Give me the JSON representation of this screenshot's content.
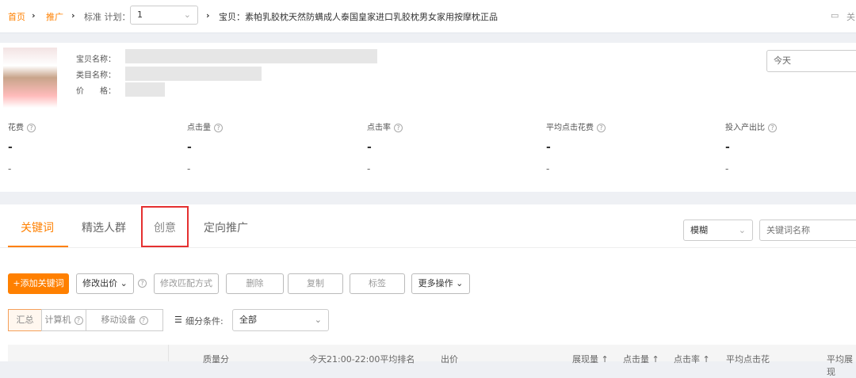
{
  "breadcrumb": {
    "home": "首页",
    "promo": "推广",
    "plan_label": "标准 计划：",
    "plan_value": "1",
    "item": "宝贝：素帕乳胶枕天然防螨成人泰国皇家进口乳胶枕男女家用按摩枕正品",
    "right": "关"
  },
  "product": {
    "name_label": "宝贝名称：",
    "category_label": "类目名称：",
    "price_label": "价　　格：",
    "date": "今天"
  },
  "metrics": [
    {
      "label": "花费",
      "v1": "-",
      "v2": "-"
    },
    {
      "label": "点击量",
      "v1": "-",
      "v2": "-"
    },
    {
      "label": "点击率",
      "v1": "-",
      "v2": "-"
    },
    {
      "label": "平均点击花费",
      "v1": "-",
      "v2": "-"
    },
    {
      "label": "投入产出比",
      "v1": "-",
      "v2": "-"
    }
  ],
  "tabs": [
    "关键词",
    "精选人群",
    "创意",
    "定向推广"
  ],
  "search": {
    "match": "模糊",
    "placeholder": "关键词名称"
  },
  "toolbar": {
    "add": "+添加关键词",
    "bid": "修改出价",
    "match": "修改匹配方式",
    "delete": "删除",
    "copy": "复制",
    "tag": "标签",
    "more": "更多操作"
  },
  "segments": [
    "汇总",
    "计算机",
    "移动设备"
  ],
  "filter": {
    "label": "细分条件:",
    "value": "全部"
  },
  "columns": [
    "质量分",
    "今天21:00-22:00平均排名",
    "出价",
    "展现量 ↑",
    "点击量 ↑",
    "点击率 ↑",
    "平均点击花",
    "平均展现"
  ]
}
